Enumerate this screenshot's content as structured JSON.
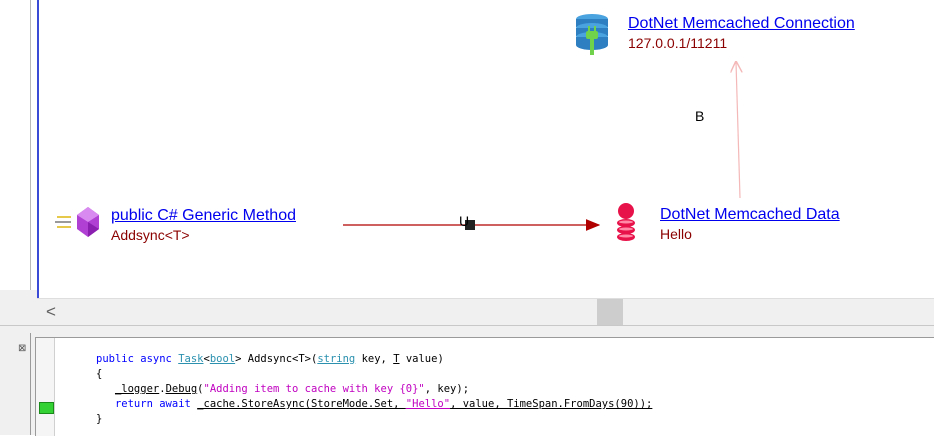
{
  "diagram": {
    "nodes": {
      "connection": {
        "title": "DotNet Memcached Connection",
        "subtitle": "127.0.0.1/11211",
        "icon": "database-plug-icon"
      },
      "method": {
        "title": "public C# Generic Method",
        "subtitle": "Addsync<T>",
        "icon": "purple-gem-method-icon"
      },
      "data": {
        "title": "DotNet Memcached Data",
        "subtitle": "Hello",
        "icon": "red-stack-data-icon"
      }
    },
    "edges": {
      "method_to_data": {
        "label": "U",
        "color": "#b00000"
      },
      "data_to_connection": {
        "label": "B",
        "color": "#f4b8b8"
      }
    }
  },
  "scrollbar": {
    "left_arrow": "<"
  },
  "code": {
    "line1": {
      "k1": "public",
      "k2": "async",
      "t1": "Task",
      "p1": "<",
      "t2": "bool",
      "p2": "> Addsync<T>(",
      "t3": "string",
      "p3": " key, ",
      "t4": "T",
      "p4": " value)"
    },
    "line2": "{",
    "line3": {
      "a": "_logger",
      "b": ".",
      "c": "Debug",
      "d": "(",
      "s": "\"Adding item to cache with key {0}\"",
      "e": ", key);"
    },
    "line4": {
      "k1": "return",
      "k2": "await",
      "a": "_cache.StoreAsync(StoreMode.Set, ",
      "s": "\"Hello\"",
      "e": ", value, TimeSpan.FromDays(90));"
    },
    "line5": "}"
  }
}
